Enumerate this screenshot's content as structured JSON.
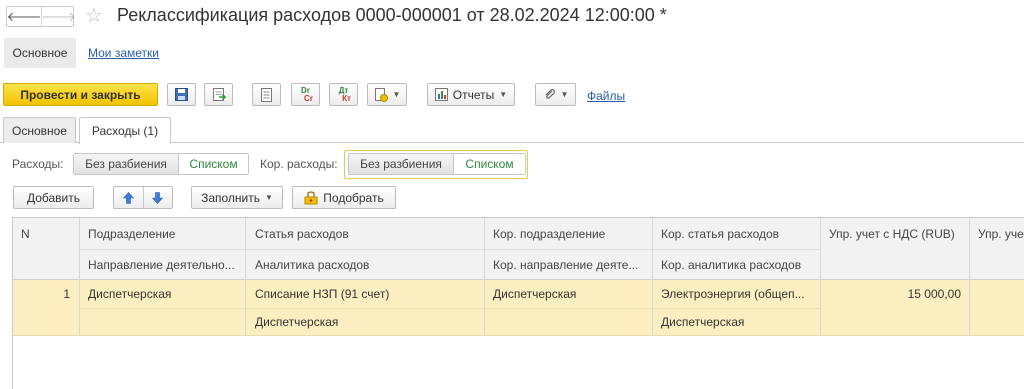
{
  "window": {
    "title": "Реклассификация расходов 0000-000001 от 28.02.2024 12:00:00 *",
    "back_glyph": "🡐",
    "forward_glyph": "🡒",
    "star_glyph": "☆"
  },
  "view_tabs": {
    "main": "Основное",
    "notes": "Мои заметки"
  },
  "toolbar": {
    "post_close": "Провести и закрыть",
    "dr_top": "Dr",
    "dr_bottom": "Cr",
    "dt_top": "Дт",
    "dt_bottom": "Кт",
    "reports": "Отчеты",
    "files": "Файлы"
  },
  "form_tabs": {
    "main": "Основное",
    "expenses": "Расходы (1)"
  },
  "switchers": {
    "expenses_label": "Расходы:",
    "cor_expenses_label": "Кор. расходы:",
    "no_split": "Без разбиения",
    "list": "Списком"
  },
  "table_toolbar": {
    "add": "Добавить",
    "fill": "Заполнить",
    "pick": "Подобрать"
  },
  "table": {
    "headers": {
      "n": "N",
      "division": "Подразделение",
      "direction": "Направление деятельно...",
      "expense_item": "Статья расходов",
      "expense_analytics": "Аналитика расходов",
      "cor_division": "Кор. подразделение",
      "cor_direction": "Кор. направление деяте...",
      "cor_expense_item": "Кор. статья расходов",
      "cor_analytics": "Кор. аналитика расходов",
      "mgmt_vat": "Упр. учет с НДС (RUB)",
      "mgmt_next": "Упр. уче"
    },
    "rows": [
      {
        "n": "1",
        "division": "Диспетчерская",
        "direction": "",
        "expense_item": "Списание НЗП (91 счет)",
        "expense_analytics": "Диспетчерская",
        "cor_division": "Диспетчерская",
        "cor_direction": "",
        "cor_expense_item": "Электроэнергия (общеп...",
        "cor_analytics": "Диспетчерская",
        "mgmt_vat": "15 000,00"
      }
    ]
  }
}
